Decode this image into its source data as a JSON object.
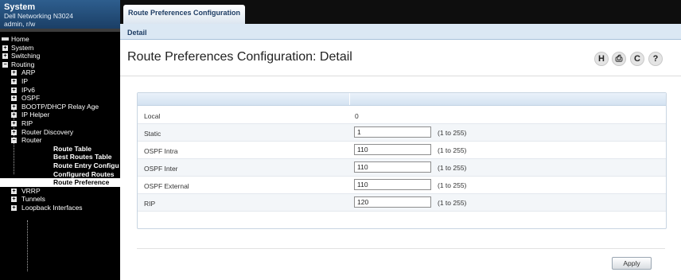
{
  "system": {
    "title": "System",
    "model": "Dell Networking N3024",
    "user": "admin, r/w"
  },
  "nav": {
    "items": [
      {
        "label": "Home",
        "toggle": "",
        "level": 0
      },
      {
        "label": "System",
        "toggle": "+",
        "level": 0
      },
      {
        "label": "Switching",
        "toggle": "+",
        "level": 0
      },
      {
        "label": "Routing",
        "toggle": "−",
        "level": 0
      },
      {
        "label": "ARP",
        "toggle": "+",
        "level": 1
      },
      {
        "label": "IP",
        "toggle": "+",
        "level": 1
      },
      {
        "label": "IPv6",
        "toggle": "+",
        "level": 1
      },
      {
        "label": "OSPF",
        "toggle": "+",
        "level": 1
      },
      {
        "label": "BOOTP/DHCP Relay Age",
        "toggle": "+",
        "level": 1
      },
      {
        "label": "IP Helper",
        "toggle": "+",
        "level": 1
      },
      {
        "label": "RIP",
        "toggle": "+",
        "level": 1
      },
      {
        "label": "Router Discovery",
        "toggle": "+",
        "level": 1
      },
      {
        "label": "Router",
        "toggle": "−",
        "level": 1
      },
      {
        "label": "Route Table",
        "toggle": "",
        "level": 2
      },
      {
        "label": "Best Routes Table",
        "toggle": "",
        "level": 2
      },
      {
        "label": "Route Entry Configu",
        "toggle": "",
        "level": 2
      },
      {
        "label": "Configured Routes",
        "toggle": "",
        "level": 2
      },
      {
        "label": "Route Preference",
        "toggle": "",
        "level": 2
      },
      {
        "label": "VRRP",
        "toggle": "+",
        "level": 1
      },
      {
        "label": "Tunnels",
        "toggle": "+",
        "level": 1
      },
      {
        "label": "Loopback Interfaces",
        "toggle": "+",
        "level": 1
      }
    ]
  },
  "tabs": {
    "active": "Route Preferences Configuration",
    "sub": "Detail"
  },
  "page": {
    "title": "Route Preferences Configuration: Detail"
  },
  "toolbar": {
    "help_glyph": "H",
    "print_glyph": "⎙",
    "refresh_glyph": "C",
    "question_glyph": "?"
  },
  "prefs": {
    "local": {
      "label": "Local",
      "value": "0"
    },
    "static": {
      "label": "Static",
      "value": "1",
      "range": "(1 to 255)"
    },
    "ospf_intra": {
      "label": "OSPF Intra",
      "value": "110",
      "range": "(1 to 255)"
    },
    "ospf_inter": {
      "label": "OSPF Inter",
      "value": "110",
      "range": "(1 to 255)"
    },
    "ospf_external": {
      "label": "OSPF External",
      "value": "110",
      "range": "(1 to 255)"
    },
    "rip": {
      "label": "RIP",
      "value": "120",
      "range": "(1 to 255)"
    }
  },
  "actions": {
    "apply_label": "Apply"
  }
}
